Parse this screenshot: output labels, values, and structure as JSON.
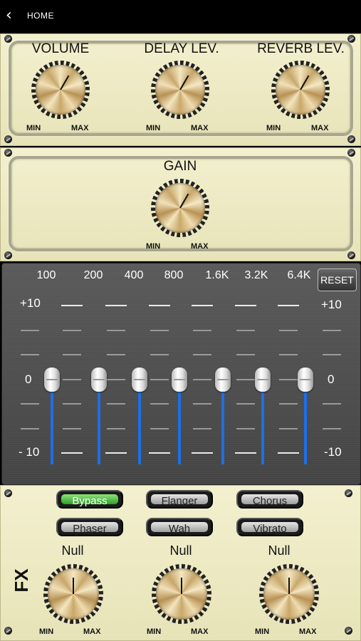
{
  "topbar": {
    "back_icon": "chevron-left-icon",
    "home_label": "HOME"
  },
  "mix": {
    "knobs": [
      {
        "label": "VOLUME",
        "min": "MIN",
        "max": "MAX",
        "angle_deg": 210
      },
      {
        "label": "DELAY LEV.",
        "min": "MIN",
        "max": "MAX",
        "angle_deg": 210
      },
      {
        "label": "REVERB LEV.",
        "min": "MIN",
        "max": "MAX",
        "angle_deg": 210
      }
    ]
  },
  "gain": {
    "label": "GAIN",
    "min": "MIN",
    "max": "MAX",
    "angle_deg": 210
  },
  "eq": {
    "bands": [
      "100",
      "200",
      "400",
      "800",
      "1.6K",
      "3.2K",
      "6.4K"
    ],
    "reset_label": "RESET",
    "scale_top": "+10",
    "scale_mid": "0",
    "scale_bottom": "- 10",
    "scale_top_right": "+10",
    "scale_bottom_right": "-10",
    "slider_values": [
      0,
      0,
      0,
      0,
      0,
      0,
      0
    ],
    "accent": "#1e6ee8"
  },
  "fx": {
    "label": "FX",
    "buttons": [
      {
        "label": "Bypass",
        "active": true
      },
      {
        "label": "Flanger",
        "active": false
      },
      {
        "label": "Chorus",
        "active": false
      },
      {
        "label": "Phaser",
        "active": false
      },
      {
        "label": "Wah",
        "active": false
      },
      {
        "label": "Vibrato",
        "active": false
      }
    ],
    "knobs": [
      {
        "label": "Null",
        "min": "MIN",
        "max": "MAX",
        "angle_deg": 180
      },
      {
        "label": "Null",
        "min": "MIN",
        "max": "MAX",
        "angle_deg": 180
      },
      {
        "label": "Null",
        "min": "MIN",
        "max": "MAX",
        "angle_deg": 180
      }
    ],
    "active_color": "#3fb536"
  }
}
